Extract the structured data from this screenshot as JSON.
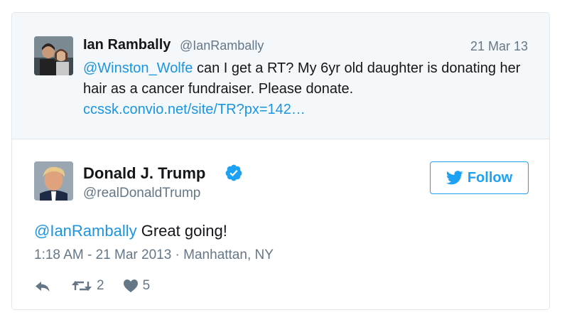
{
  "quoted_tweet": {
    "name": "Ian Rambally",
    "handle": "@IanRambally",
    "date": "21 Mar 13",
    "mention": "@Winston_Wolfe",
    "text": " can I get a RT? My 6yr old daughter is donating her hair as a cancer fundraiser. Please donate.",
    "link": "ccssk.convio.net/site/TR?px=142…"
  },
  "tweet": {
    "name": "Donald J. Trump",
    "handle": "@realDonaldTrump",
    "verified": true,
    "follow_label": "Follow",
    "mention": "@IanRambally",
    "text": " Great going!",
    "meta": "1:18 AM - 21 Mar 2013 · Manhattan, NY",
    "retweet_count": "2",
    "like_count": "5"
  },
  "colors": {
    "link": "#1b95e0",
    "twitter_blue": "#1da1f2",
    "muted": "#657786",
    "border": "#e1e8ed",
    "quoted_bg": "#f5f8fa"
  },
  "icons": [
    "reply-icon",
    "retweet-icon",
    "heart-icon",
    "verified-badge-icon",
    "twitter-bird-icon"
  ]
}
